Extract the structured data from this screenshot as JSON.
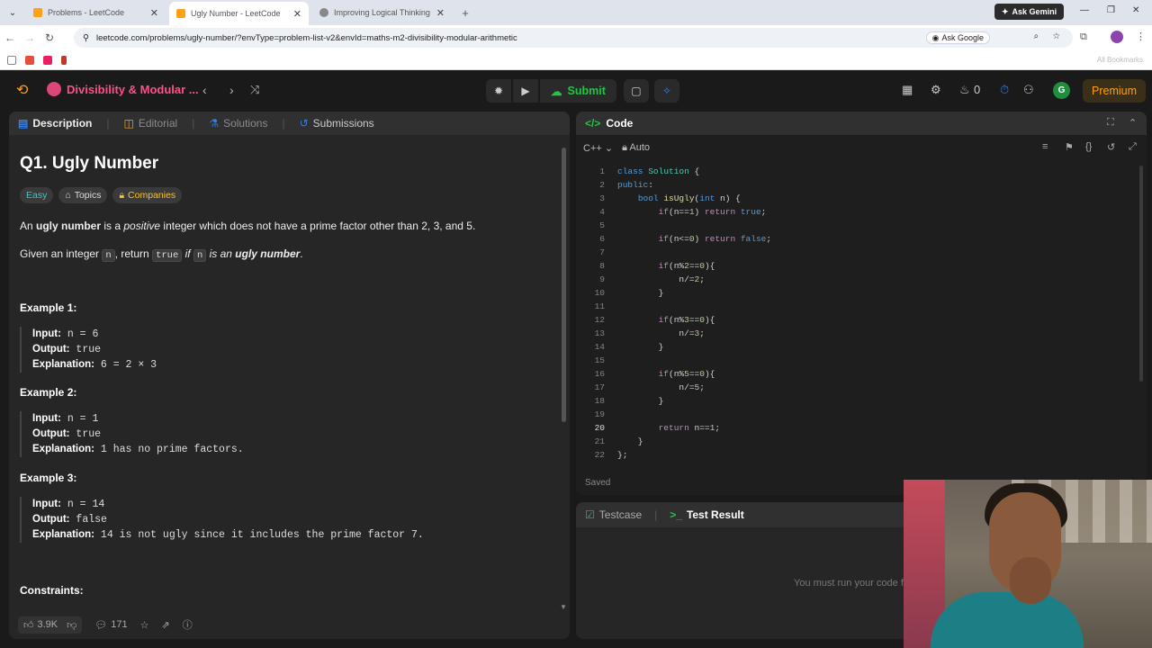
{
  "browser": {
    "tabs": [
      {
        "title": "Problems - LeetCode",
        "active": false
      },
      {
        "title": "Ugly Number - LeetCode",
        "active": true
      },
      {
        "title": "Improving Logical Thinking",
        "active": false
      }
    ],
    "ask_gemini": "Ask Gemini",
    "url": "leetcode.com/problems/ugly-number/?envType=problem-list-v2&envId=maths-m2-divisibility-modular-arithmetic",
    "ask_google": "Ask Google",
    "all_bookmarks": "All Bookmarks"
  },
  "topbar": {
    "list_title": "Divisibility & Modular ...",
    "submit_label": "Submit",
    "streak_count": "0",
    "avatar_letter": "G",
    "premium_label": "Premium"
  },
  "left": {
    "tabs": [
      "Description",
      "Editorial",
      "Solutions",
      "Submissions"
    ],
    "title": "Q1. Ugly Number",
    "badges": [
      "Easy",
      "Topics",
      "Companies"
    ],
    "desc1_pre": "An ",
    "desc1_bold": "ugly number",
    "desc1_mid": " is a ",
    "desc1_em": "positive",
    "desc1_post": " integer which does not have a prime factor other than 2, 3, and 5.",
    "desc2_pre": "Given an integer ",
    "desc2_code1": "n",
    "desc2_mid": ", return ",
    "desc2_code2": "true",
    "desc2_if": " if ",
    "desc2_code3": "n",
    "desc2_is": " is an ",
    "desc2_bold": "ugly number",
    "desc2_end": ".",
    "examples": [
      {
        "heading": "Example 1:",
        "input": "n = 6",
        "output": "true",
        "explanation": "6 = 2 × 3"
      },
      {
        "heading": "Example 2:",
        "input": "n = 1",
        "output": "true",
        "explanation": "1 has no prime factors."
      },
      {
        "heading": "Example 3:",
        "input": "n = 14",
        "output": "false",
        "explanation": "14 is not ugly since it includes the prime factor 7."
      }
    ],
    "labels": {
      "input": "Input:",
      "output": "Output:",
      "explanation": "Explanation:"
    },
    "constraints_heading": "Constraints:",
    "likes": "3.9K",
    "comments": "171"
  },
  "code_panel": {
    "title": "Code",
    "language": "C++",
    "auto_label": "Auto",
    "saved": "Saved",
    "line_numbers": [
      "1",
      "2",
      "3",
      "4",
      "5",
      "6",
      "7",
      "8",
      "9",
      "10",
      "11",
      "12",
      "13",
      "14",
      "15",
      "16",
      "17",
      "18",
      "19",
      "20",
      "21",
      "22"
    ]
  },
  "test_panel": {
    "tab_testcase": "Testcase",
    "tab_result": "Test Result",
    "message": "You must run your code first"
  }
}
